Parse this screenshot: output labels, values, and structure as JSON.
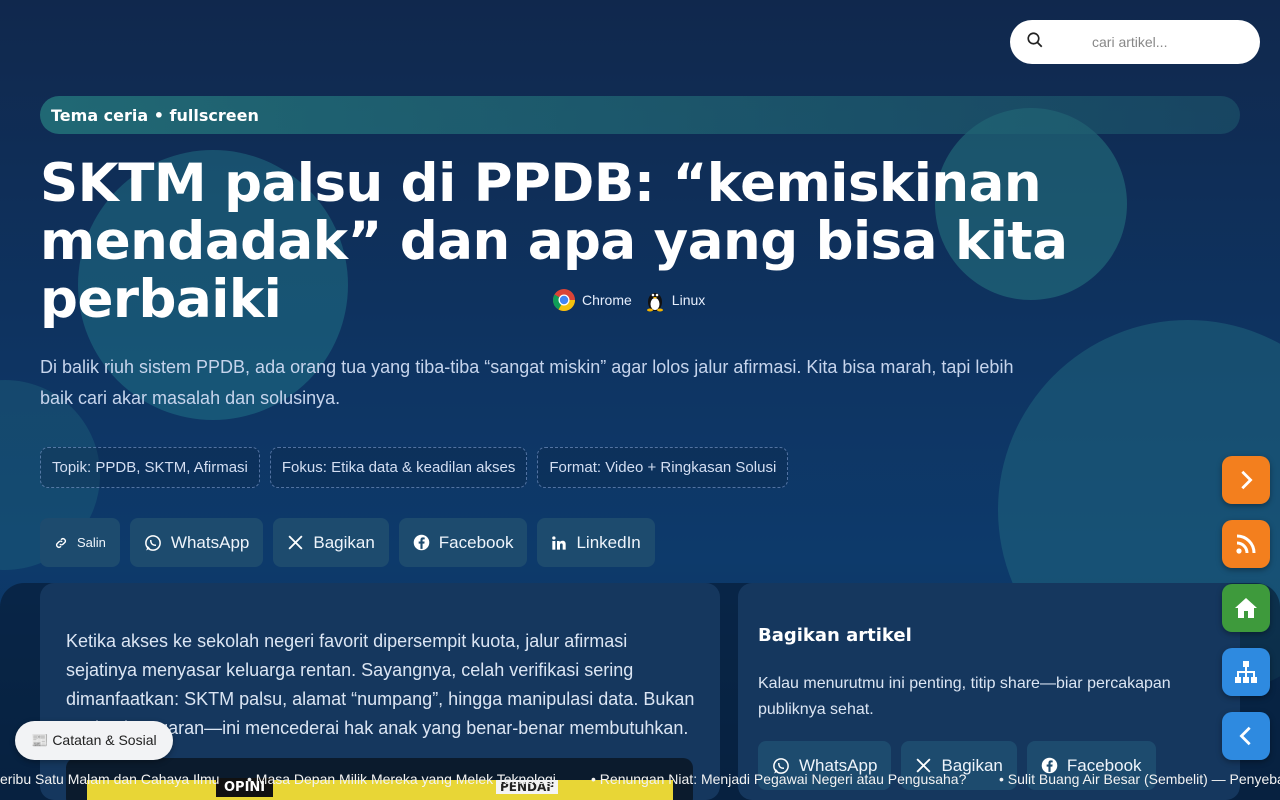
{
  "search": {
    "placeholder": "cari artikel..."
  },
  "theme_bar": {
    "label": "Tema ceria • fullscreen"
  },
  "article": {
    "title": "SKTM palsu di PPDB: “kemiskinan mendadak” dan apa yang bisa kita perbaiki",
    "env": [
      {
        "icon": "chrome-icon",
        "label": "Chrome"
      },
      {
        "icon": "linux-icon",
        "label": "Linux"
      }
    ],
    "lead": "Di balik riuh sistem PPDB, ada orang tua yang tiba-tiba “sangat miskin” agar lolos jalur afirmasi. Kita bisa marah, tapi lebih baik cari akar masalah dan solusinya.",
    "chips": [
      "Topik: PPDB, SKTM, Afirmasi",
      "Fokus: Etika data & keadilan akses",
      "Format: Video + Ringkasan Solusi"
    ],
    "share": {
      "copy": "Salin",
      "whatsapp": "WhatsApp",
      "x": "Bagikan",
      "facebook": "Facebook",
      "linkedin": "LinkedIn"
    },
    "body_intro": "Ketika akses ke sekolah negeri favorit dipersempit kuota, jalur afirmasi sejatinya menyasar keluarga rentan. Sayangnya, celah verifikasi sering dimanfaatkan: SKTM palsu, alamat “numpang”, hingga manipulasi data. Bukan soal pelanggaran—ini mencederai hak anak yang benar-benar membutuhkan.",
    "video_thumb": {
      "logo": "OPINI",
      "text": "PENDAF"
    }
  },
  "sidebar": {
    "title": "Bagikan artikel",
    "desc": "Kalau menurutmu ini penting, titip share—biar percakapan publiknya sehat.",
    "share": {
      "whatsapp": "WhatsApp",
      "x": "Bagikan",
      "facebook": "Facebook"
    }
  },
  "fabs": [
    "next-icon",
    "rss-icon",
    "home-icon",
    "sitemap-icon",
    "back-icon"
  ],
  "toast": {
    "label": "📰 Catatan & Sosial"
  },
  "ticker": [
    "eribu Satu Malam dan Cahaya Ilmu",
    "• Masa Depan Milik Mereka yang Melek Teknologi",
    "• Renungan Niat: Menjadi Pegawai Negeri atau Pengusaha?",
    "• Sulit Buang Air Besar (Sembelit) — Penyeba"
  ],
  "colors": {
    "accent_orange": "#f37f1e",
    "accent_green": "#3e9a3c",
    "accent_blue": "#2e8ae0",
    "bg": "#0e3462"
  }
}
